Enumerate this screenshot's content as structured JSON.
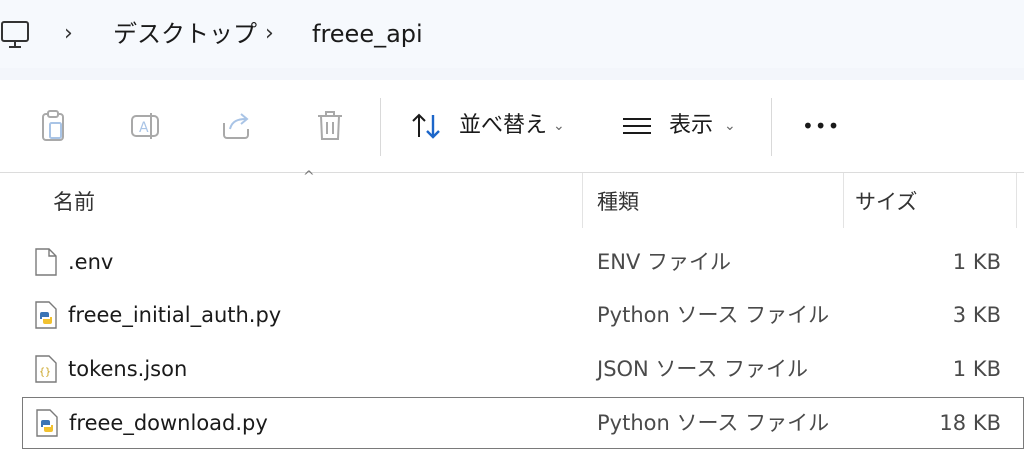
{
  "breadcrumb": {
    "items": [
      "デスクトップ",
      "freee_api"
    ]
  },
  "toolbar": {
    "sort_label": "並べ替え",
    "view_label": "表示",
    "more_label": "•••"
  },
  "columns": {
    "name": "名前",
    "type": "種類",
    "size": "サイズ"
  },
  "files": [
    {
      "name": ".env",
      "type": "ENV ファイル",
      "size": "1 KB",
      "icon": "blank-file-icon"
    },
    {
      "name": "freee_initial_auth.py",
      "type": "Python ソース ファイル",
      "size": "3 KB",
      "icon": "python-file-icon"
    },
    {
      "name": "tokens.json",
      "type": "JSON ソース ファイル",
      "size": "1 KB",
      "icon": "json-file-icon"
    },
    {
      "name": "freee_download.py",
      "type": "Python ソース ファイル",
      "size": "18 KB",
      "icon": "python-file-icon",
      "selected": true
    }
  ],
  "colors": {
    "breadcrumb_bg": "#f6f9fd",
    "selection_border": "#7a7a7a",
    "sort_arrow_blue": "#1c66c9"
  }
}
